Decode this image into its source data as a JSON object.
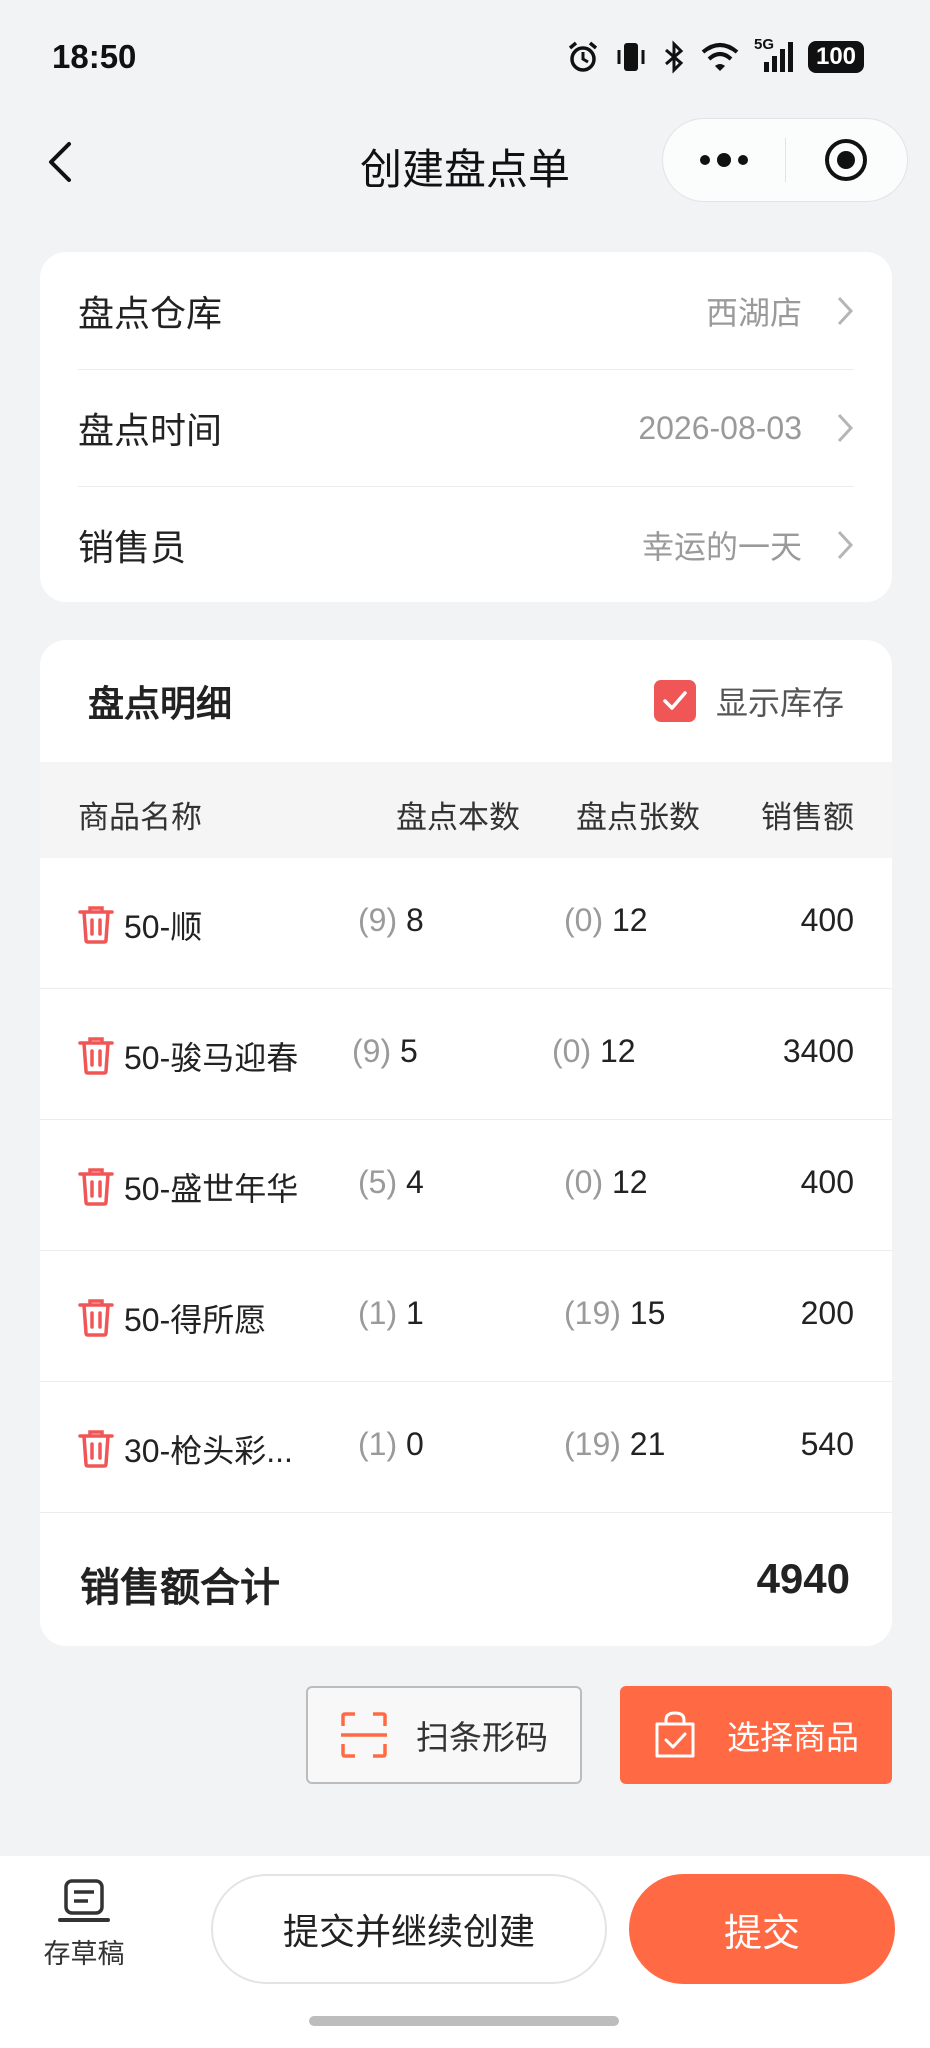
{
  "status_bar": {
    "time": "18:50",
    "network_label": "5G",
    "battery": "100",
    "icons": [
      "alarm-icon",
      "vibrate-icon",
      "bluetooth-icon",
      "wifi-icon",
      "signal-icon",
      "battery-icon"
    ]
  },
  "nav": {
    "title": "创建盘点单",
    "back_icon": "chevron-left-icon",
    "more_icon": "more-dots-icon",
    "close_icon": "target-close-icon"
  },
  "info": {
    "rows": [
      {
        "label": "盘点仓库",
        "value": "西湖店"
      },
      {
        "label": "盘点时间",
        "value": "2026-08-03"
      },
      {
        "label": "销售员",
        "value": "幸运的一天"
      }
    ]
  },
  "detail": {
    "title": "盘点明细",
    "show_stock_label": "显示库存",
    "show_stock_checked": true,
    "columns": {
      "name": "商品名称",
      "books": "盘点本数",
      "sheets": "盘点张数",
      "sales": "销售额"
    },
    "rows": [
      {
        "name": "50-顺",
        "books_prev": "(9)",
        "books": "8",
        "sheets_prev": "(0)",
        "sheets": "12",
        "sales": "400"
      },
      {
        "name": "50-骏马迎春",
        "books_prev": "(9)",
        "books": "5",
        "sheets_prev": "(0)",
        "sheets": "12",
        "sales": "3400"
      },
      {
        "name": "50-盛世年华",
        "books_prev": "(5)",
        "books": "4",
        "sheets_prev": "(0)",
        "sheets": "12",
        "sales": "400"
      },
      {
        "name": "50-得所愿",
        "books_prev": "(1)",
        "books": "1",
        "sheets_prev": "(19)",
        "sheets": "15",
        "sales": "200"
      },
      {
        "name": "30-枪头彩...",
        "books_prev": "(1)",
        "books": "0",
        "sheets_prev": "(19)",
        "sheets": "21",
        "sales": "540"
      }
    ],
    "total_label": "销售额合计",
    "total_value": "4940"
  },
  "actions": {
    "scan_label": "扫条形码",
    "select_label": "选择商品"
  },
  "bottom": {
    "draft_label": "存草稿",
    "continue_label": "提交并继续创建",
    "submit_label": "提交"
  },
  "colors": {
    "accent": "#ff6a45",
    "delete": "#f05656",
    "background": "#f2f3f5"
  }
}
